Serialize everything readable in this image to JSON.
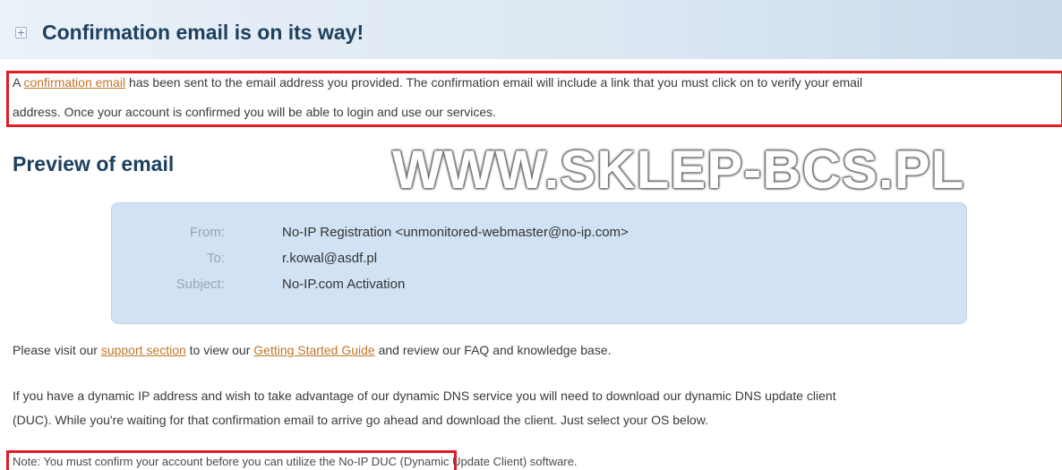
{
  "header": {
    "icon": "plus-icon",
    "title": "Confirmation email is on its way!"
  },
  "confirmation": {
    "prefix": "A ",
    "link": "confirmation email",
    "line1_rest": " has been sent to the email address you provided. The confirmation email will include a link that you must click on to verify your email",
    "line2": "address. Once your account is confirmed you will be able to login and use our services."
  },
  "preview": {
    "title": "Preview of email",
    "from_label": "From:",
    "from_value": "No-IP Registration <unmonitored-webmaster@no-ip.com>",
    "to_label": "To:",
    "to_value": "r.kowal@asdf.pl",
    "subject_label": "Subject:",
    "subject_value": "No-IP.com Activation"
  },
  "watermark": "WWW.SKLEP-BCS.PL",
  "support": {
    "p1": "Please visit our ",
    "support_link": "support section",
    "p2": " to view our ",
    "guide_link": "Getting Started Guide",
    "p3": " and review our FAQ and knowledge base."
  },
  "dynamic": {
    "line1": "If you have a dynamic IP address and wish to take advantage of our dynamic DNS service you will need to download our dynamic DNS update client",
    "line2": "(DUC). While you're waiting for that confirmation email to arrive go ahead and download the client. Just select your OS below."
  },
  "note": "Note: You must confirm your account before you can utilize the No-IP DUC (Dynamic Update Client) software.",
  "colors": {
    "title": "#1d4060",
    "link": "#c0762b",
    "highlight_border": "#e01c24",
    "email_box": "#d1e2f4"
  }
}
